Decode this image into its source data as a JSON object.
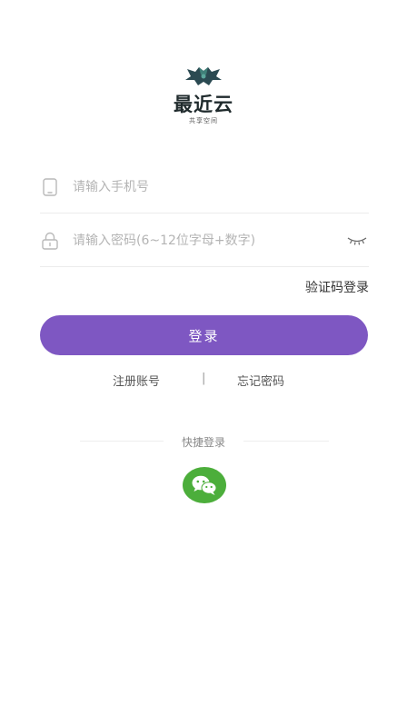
{
  "brand": {
    "name": "最近云",
    "tagline": "共享空间"
  },
  "form": {
    "phone_placeholder": "请输入手机号",
    "password_placeholder": "请输入密码(6~12位字母+数字)"
  },
  "actions": {
    "sms_login": "验证码登录",
    "login": "登录",
    "register": "注册账号",
    "separator": "|",
    "forgot": "忘记密码"
  },
  "quick_login": {
    "label": "快捷登录",
    "wechat_icon": "wechat-icon"
  },
  "colors": {
    "primary": "#7e57c2",
    "wechat": "#4cae3b",
    "logo": "#1f2a2c"
  }
}
